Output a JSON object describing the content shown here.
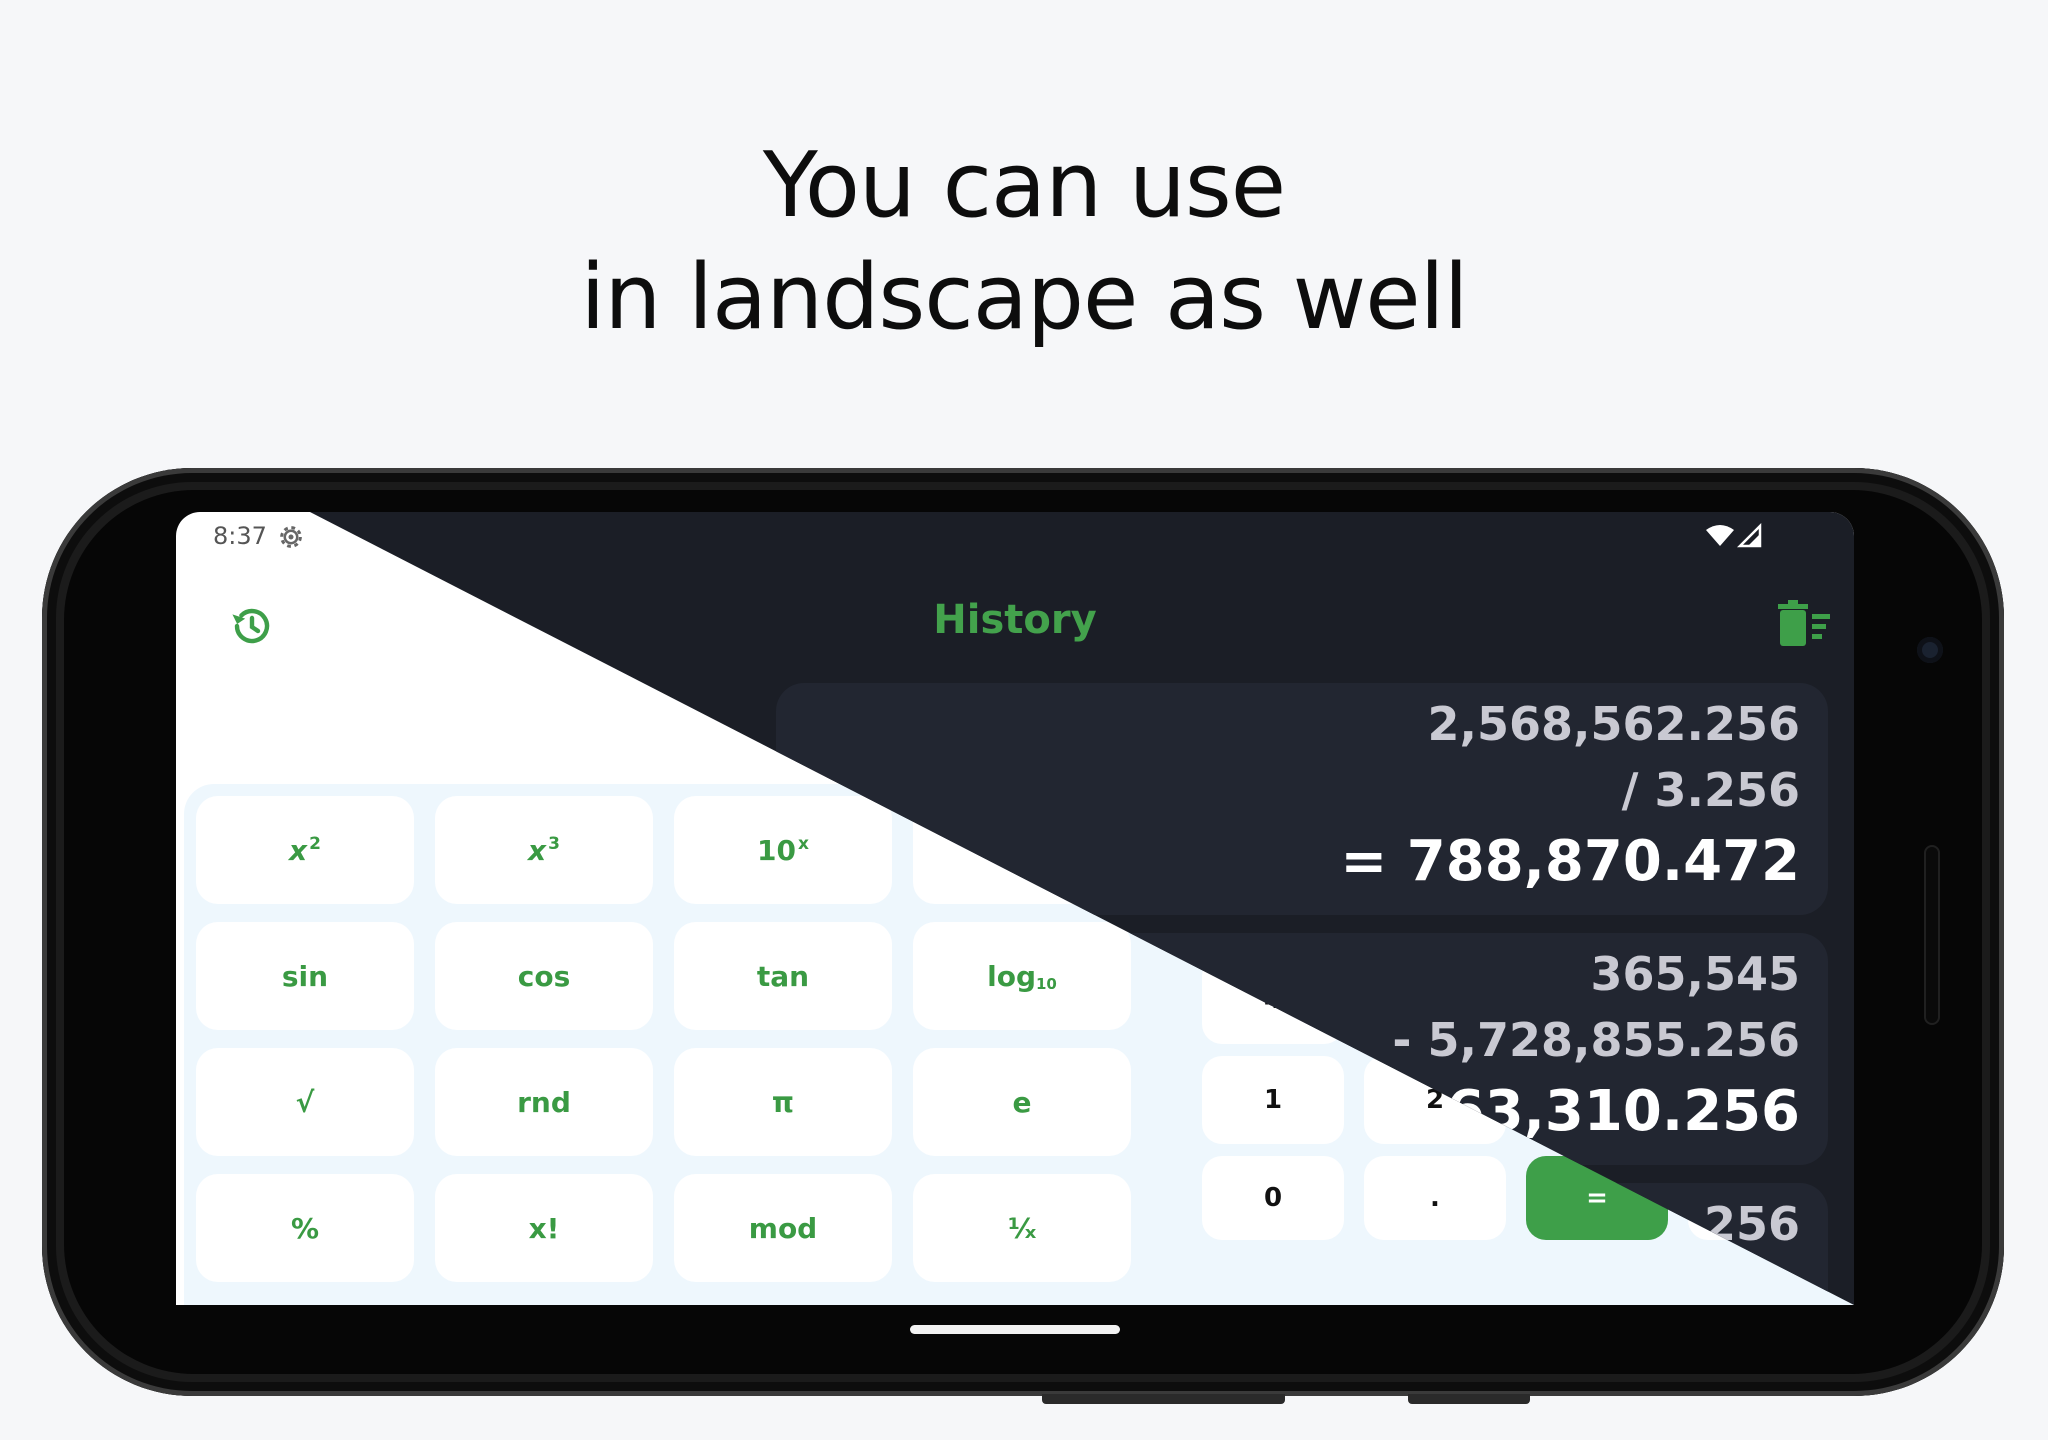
{
  "headline": {
    "line1": "You can use",
    "line2": "in landscape as well"
  },
  "status_bar": {
    "time": "8:37"
  },
  "scientific_keys": [
    {
      "label": "x",
      "sup": "2",
      "sub": ""
    },
    {
      "label": "x",
      "sup": "3",
      "sub": ""
    },
    {
      "label": "10",
      "sup": "x",
      "sub": ""
    },
    {
      "label": "",
      "sup": "",
      "sub": ""
    },
    {
      "label": "sin",
      "sup": "",
      "sub": ""
    },
    {
      "label": "cos",
      "sup": "",
      "sub": ""
    },
    {
      "label": "tan",
      "sup": "",
      "sub": ""
    },
    {
      "label": "log",
      "sup": "",
      "sub": "10"
    },
    {
      "label": "√",
      "sup": "",
      "sub": ""
    },
    {
      "label": "rnd",
      "sup": "",
      "sub": ""
    },
    {
      "label": "π",
      "sup": "",
      "sub": ""
    },
    {
      "label": "e",
      "sup": "",
      "sub": ""
    },
    {
      "label": "%",
      "sup": "",
      "sub": ""
    },
    {
      "label": "x!",
      "sup": "",
      "sub": ""
    },
    {
      "label": "mod",
      "sup": "",
      "sub": ""
    },
    {
      "label": "¹⁄ₓ",
      "sup": "",
      "sub": ""
    }
  ],
  "number_keys": {
    "four": "4",
    "one": "1",
    "two": "2",
    "zero": "0",
    "dot": ".",
    "equals": "="
  },
  "history": {
    "title": "History",
    "entries": [
      {
        "operand": "2,568,562.256",
        "operation": "/ 3.256",
        "result": "= 788,870.472"
      },
      {
        "operand": "365,545",
        "operation": "- 5,728,855.256",
        "result": "363,310.256"
      },
      {
        "operand": "256",
        "operation": "",
        "result": ""
      }
    ]
  },
  "colors": {
    "accent": "#3e9f49",
    "dark_bg": "#1b1e26",
    "panel_bg": "#eef7fd"
  }
}
